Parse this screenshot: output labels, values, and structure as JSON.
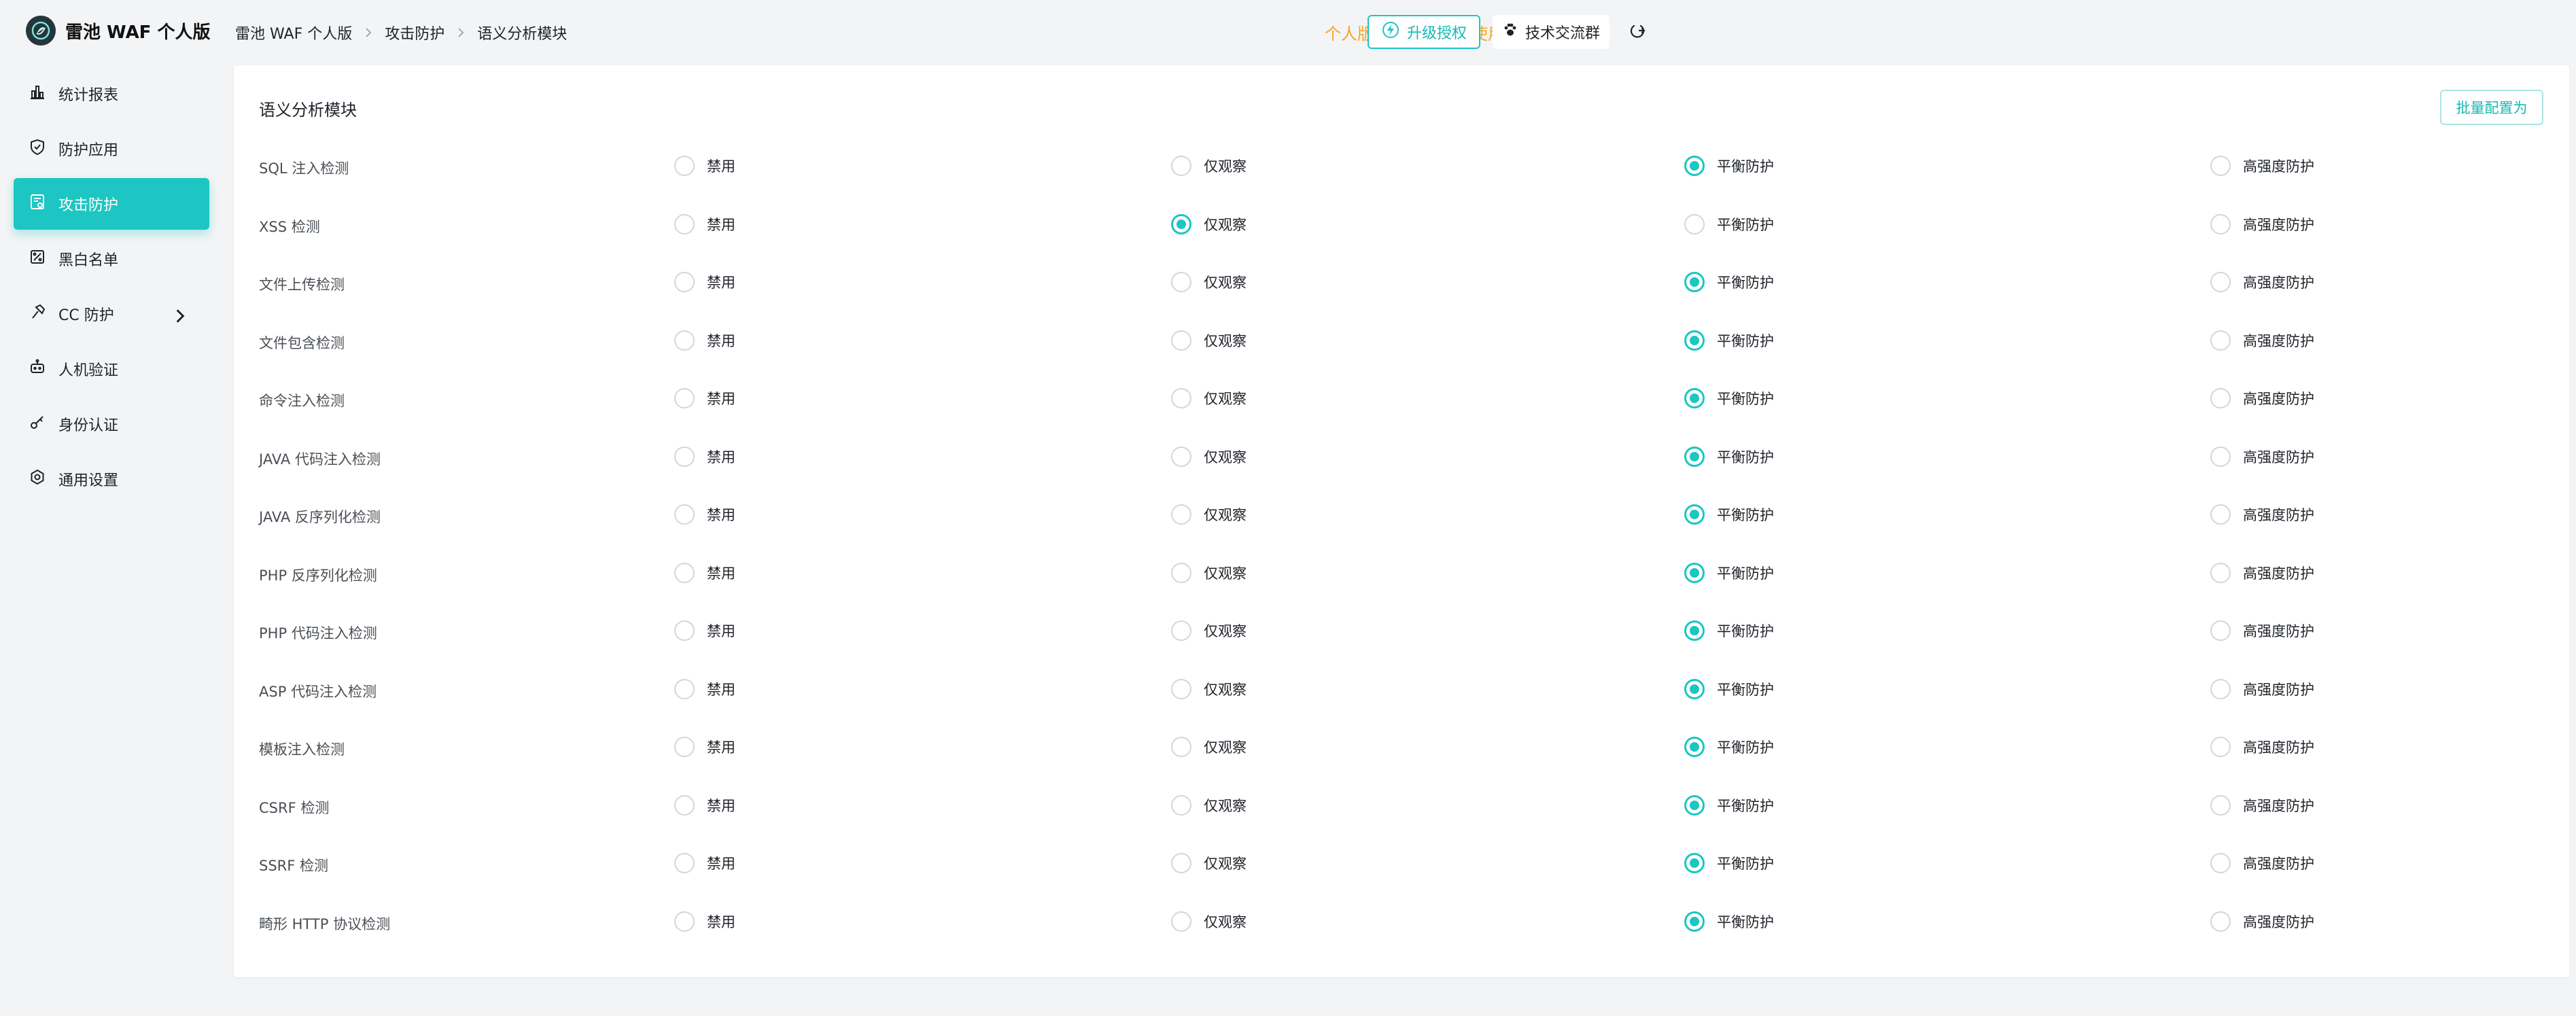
{
  "app": {
    "name": "雷池 WAF 个人版"
  },
  "breadcrumb": [
    "雷池 WAF 个人版",
    "攻击防护",
    "语义分析模块"
  ],
  "notice": "个人版禁止商业用途使用",
  "header": {
    "upgrade_label": "升级授权",
    "group_label": "技术交流群"
  },
  "colors": {
    "accent": "#1bc6c3",
    "notice": "#f5a623"
  },
  "sidebar": {
    "items": [
      {
        "label": "统计报表",
        "icon": "bar-chart-icon",
        "active": false
      },
      {
        "label": "防护应用",
        "icon": "shield-icon",
        "active": false
      },
      {
        "label": "攻击防护",
        "icon": "attack-protect-icon",
        "active": true
      },
      {
        "label": "黑白名单",
        "icon": "list-icon",
        "active": false
      },
      {
        "label": "CC 防护",
        "icon": "hammer-icon",
        "active": false,
        "expandable": true
      },
      {
        "label": "人机验证",
        "icon": "robot-icon",
        "active": false
      },
      {
        "label": "身份认证",
        "icon": "key-icon",
        "active": false
      },
      {
        "label": "通用设置",
        "icon": "gear-icon",
        "active": false
      }
    ]
  },
  "module": {
    "title": "语义分析模块",
    "batch_label": "批量配置为",
    "options": [
      "禁用",
      "仅观察",
      "平衡防护",
      "高强度防护"
    ],
    "rows": [
      {
        "label": "SQL 注入检测",
        "selected": 2
      },
      {
        "label": "XSS 检测",
        "selected": 1
      },
      {
        "label": "文件上传检测",
        "selected": 2
      },
      {
        "label": "文件包含检测",
        "selected": 2
      },
      {
        "label": "命令注入检测",
        "selected": 2
      },
      {
        "label": "JAVA 代码注入检测",
        "selected": 2
      },
      {
        "label": "JAVA 反序列化检测",
        "selected": 2
      },
      {
        "label": "PHP 反序列化检测",
        "selected": 2
      },
      {
        "label": "PHP 代码注入检测",
        "selected": 2
      },
      {
        "label": "ASP 代码注入检测",
        "selected": 2
      },
      {
        "label": "模板注入检测",
        "selected": 2
      },
      {
        "label": "CSRF 检测",
        "selected": 2
      },
      {
        "label": "SSRF 检测",
        "selected": 2
      },
      {
        "label": "畸形 HTTP 协议检测",
        "selected": 2
      }
    ]
  }
}
